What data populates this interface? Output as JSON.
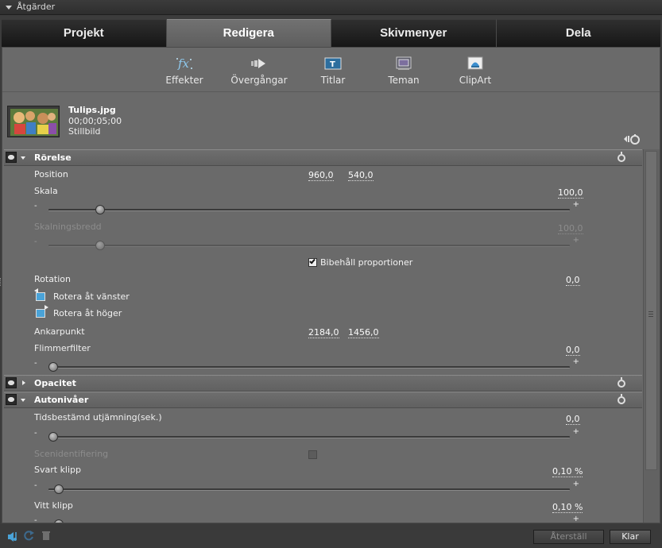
{
  "panel_title": "Åtgärder",
  "tabs": [
    "Projekt",
    "Redigera",
    "Skivmenyer",
    "Dela"
  ],
  "active_tab": "Redigera",
  "toolbar": [
    {
      "label": "Effekter",
      "icon": "fx-icon"
    },
    {
      "label": "Övergångar",
      "icon": "transition-icon"
    },
    {
      "label": "Titlar",
      "icon": "titles-icon"
    },
    {
      "label": "Teman",
      "icon": "themes-icon"
    },
    {
      "label": "ClipArt",
      "icon": "clipart-icon"
    }
  ],
  "clip": {
    "name": "Tulips.jpg",
    "duration": "00;00;05;00",
    "type": "Stillbild"
  },
  "sections": {
    "motion": {
      "title": "Rörelse",
      "position": {
        "label": "Position",
        "x": "960,0",
        "y": "540,0"
      },
      "scale": {
        "label": "Skala",
        "value": "100,0",
        "slider_fraction": 0.09
      },
      "scale_width": {
        "label": "Skalningsbredd",
        "value": "100,0",
        "slider_fraction": 0.09
      },
      "keep_proportions": {
        "label": "Bibehåll proportioner",
        "checked": true
      },
      "rotation": {
        "label": "Rotation",
        "value": "0,0"
      },
      "rotate_left": "Rotera åt vänster",
      "rotate_right": "Rotera åt höger",
      "anchor": {
        "label": "Ankarpunkt",
        "x": "2184,0",
        "y": "1456,0"
      },
      "flicker": {
        "label": "Flimmerfilter",
        "value": "0,0",
        "slider_fraction": 0.0
      }
    },
    "opacity": {
      "title": "Opacitet"
    },
    "auto_levels": {
      "title": "Autonivåer",
      "smoothing": {
        "label": "Tidsbestämd utjämning(sek.)",
        "value": "0,0",
        "slider_fraction": 0.0
      },
      "scene_detect": {
        "label": "Scenidentifiering",
        "checked": false
      },
      "black_clip": {
        "label": "Svart klipp",
        "value": "0,10 %",
        "slider_fraction": 0.01
      },
      "white_clip": {
        "label": "Vitt klipp",
        "value": "0,10 %",
        "slider_fraction": 0.01
      }
    }
  },
  "slider_minus": "-",
  "slider_plus": "+",
  "buttons": {
    "reset": "Återställ",
    "done": "Klar"
  },
  "colors": {
    "accent_blue": "#4aa3d8",
    "panel_bg": "#6a6a6a",
    "tab_active": "#676767"
  }
}
